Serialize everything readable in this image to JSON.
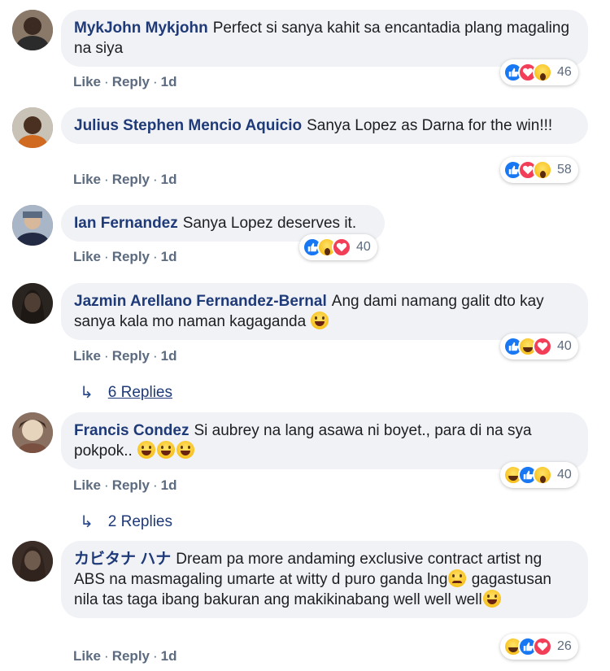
{
  "action_like": "Like",
  "action_reply": "Reply",
  "dot": "·",
  "comments": [
    {
      "author": "MykJohn Mykjohn",
      "text": "Perfect si sanya kahit sa encantadia plang magaling na siya",
      "time": "1d",
      "reactions": [
        "like-icon",
        "love-icon",
        "wow-icon"
      ],
      "reaction_count": "46"
    },
    {
      "author": "Julius Stephen Mencio Aquicio",
      "text": "Sanya Lopez as Darna for the win!!!",
      "time": "1d",
      "reactions": [
        "like-icon",
        "love-icon",
        "wow-icon"
      ],
      "reaction_count": "58"
    },
    {
      "author": "Ian Fernandez",
      "text": "Sanya Lopez deserves it.",
      "time": "1d",
      "reactions": [
        "like-icon",
        "wow-icon",
        "love-icon"
      ],
      "reaction_count": "40"
    },
    {
      "author": "Jazmin Arellano Fernandez-Bernal",
      "text": "Ang dami namang galit dto kay sanya kala mo naman kagaganda",
      "time": "1d",
      "reactions": [
        "like-icon",
        "haha-icon",
        "love-icon"
      ],
      "reaction_count": "40",
      "replies_label": "6 Replies"
    },
    {
      "author": "Francis Condez",
      "text": "Si aubrey na lang asawa ni boyet., para di na sya pokpok..",
      "time": "1d",
      "reactions": [
        "haha-icon",
        "like-icon",
        "wow-icon"
      ],
      "reaction_count": "40",
      "replies_label": "2 Replies"
    },
    {
      "author": "カビタナ ハナ",
      "text_1": "Dream pa more andaming exclusive contract artist ng ABS na masmagaling umarte at witty d puro ganda lng",
      "text_2": "gagastusan nila tas taga ibang bakuran ang makikinabang well well well",
      "time": "1d",
      "reactions": [
        "haha-icon",
        "like-icon",
        "love-icon"
      ],
      "reaction_count": "26"
    }
  ]
}
